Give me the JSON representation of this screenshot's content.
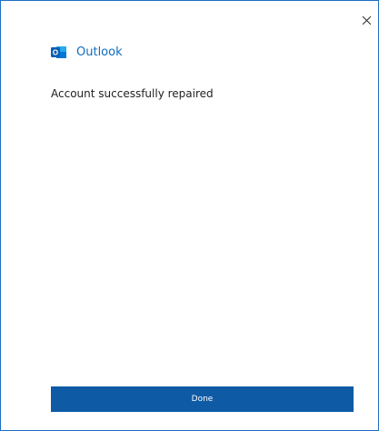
{
  "dialog": {
    "brand": {
      "icon": "outlook-logo-icon",
      "logo_letter": "O",
      "name": "Outlook"
    },
    "message": "Account successfully repaired",
    "close_icon": "close-icon",
    "done_label": "Done"
  },
  "colors": {
    "border": "#1e6fc4",
    "brand_text": "#0f6cbd",
    "button_bg": "#0f5aa5",
    "button_text": "#ffffff",
    "message_text": "#1f1f1f"
  }
}
